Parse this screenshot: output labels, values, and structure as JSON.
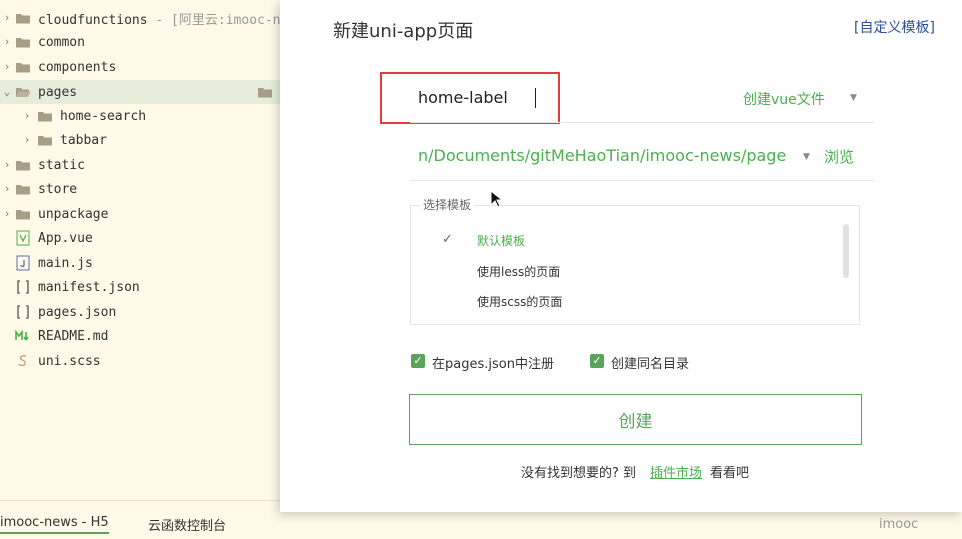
{
  "explorer": {
    "items": [
      {
        "label": "cloudfunctions",
        "suffix": " - [阿里云:imooc-n"
      },
      {
        "label": "common"
      },
      {
        "label": "components"
      },
      {
        "label": "pages"
      },
      {
        "label": "home-search"
      },
      {
        "label": "tabbar"
      },
      {
        "label": "static"
      },
      {
        "label": "store"
      },
      {
        "label": "unpackage"
      },
      {
        "label": "App.vue"
      },
      {
        "label": "main.js"
      },
      {
        "label": "manifest.json"
      },
      {
        "label": "pages.json"
      },
      {
        "label": "README.md"
      },
      {
        "label": "uni.scss"
      }
    ]
  },
  "bottom": {
    "tab_project": "imooc-news - H5",
    "tab_console": "云函数控制台",
    "brand": "imooc"
  },
  "dialog": {
    "title": "新建uni-app页面",
    "custom_template": "[自定义模板]",
    "page_name": "home-label",
    "vue_select": "创建vue文件",
    "path": "n/Documents/gitMeHaoTian/imooc-news/pages",
    "browse": "浏览",
    "template_legend": "选择模板",
    "templates": [
      "默认模板",
      "使用less的页面",
      "使用scss的页面"
    ],
    "check_register": "在pages.json中注册",
    "check_dir": "创建同名目录",
    "create": "创建",
    "hint_prefix": "没有找到想要的? 到",
    "hint_link": "插件市场",
    "hint_suffix": "看看吧"
  },
  "colors": {
    "accent": "#4caf50",
    "highlight": "#e23c3c",
    "sidebar_bg": "#fffae8"
  }
}
